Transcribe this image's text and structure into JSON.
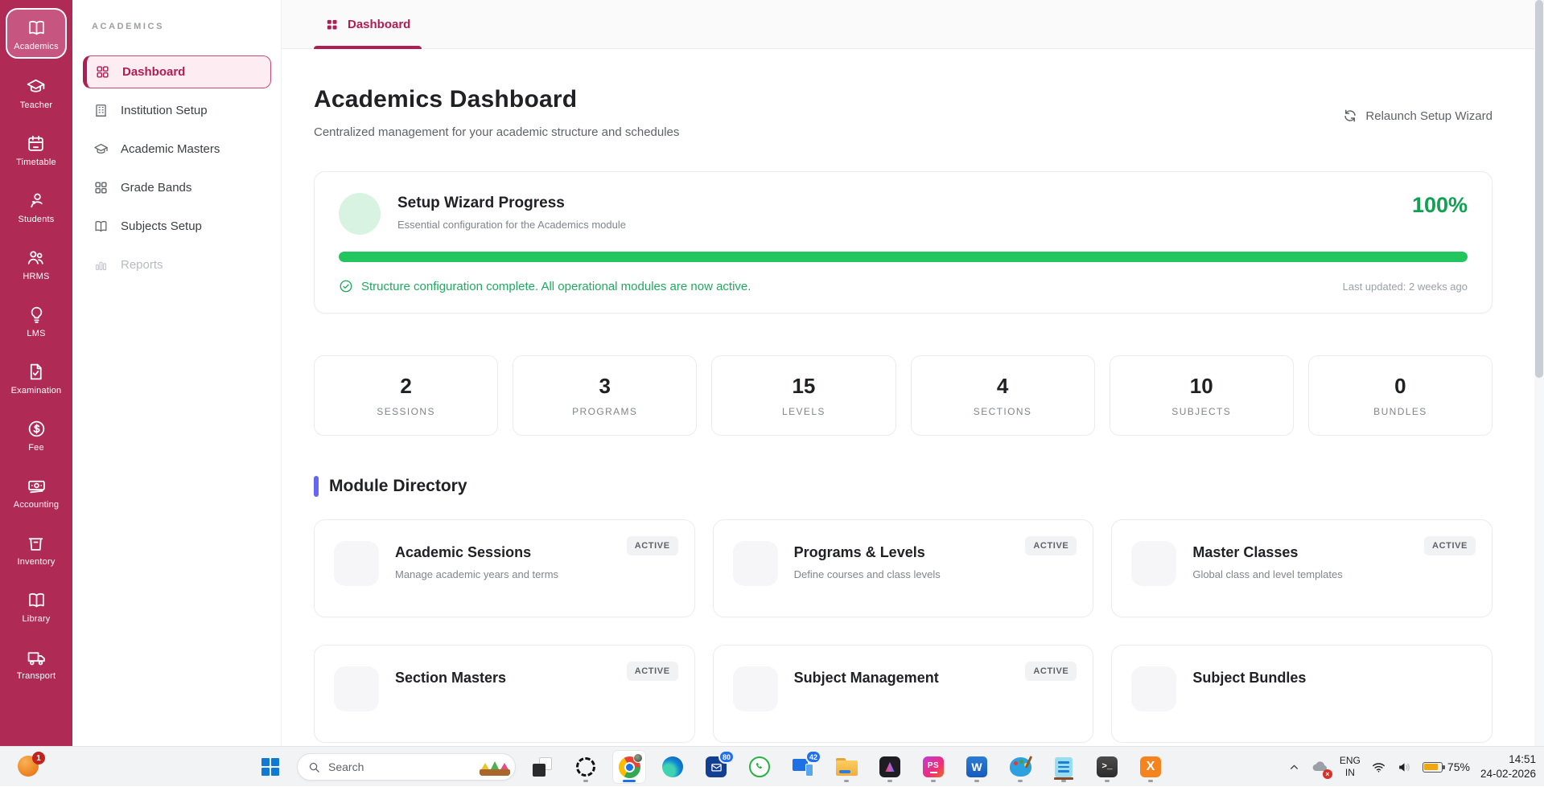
{
  "colors": {
    "rail_bg": "#b02a56",
    "accent": "#b01d53",
    "progress_green": "#22c55e",
    "status_green": "#1faa5f",
    "module_heading_bar": "#6366f1"
  },
  "app_rail": {
    "items": [
      {
        "label": "Academics",
        "icon": "book-open-icon",
        "active": true
      },
      {
        "label": "Teacher",
        "icon": "graduation-cap-icon"
      },
      {
        "label": "Timetable",
        "icon": "calendar-icon"
      },
      {
        "label": "Students",
        "icon": "student-icon"
      },
      {
        "label": "HRMS",
        "icon": "people-icon"
      },
      {
        "label": "LMS",
        "icon": "lightbulb-icon"
      },
      {
        "label": "Examination",
        "icon": "document-check-icon"
      },
      {
        "label": "Fee",
        "icon": "dollar-circle-icon"
      },
      {
        "label": "Accounting",
        "icon": "banknote-icon"
      },
      {
        "label": "Inventory",
        "icon": "box-icon"
      },
      {
        "label": "Library",
        "icon": "book-icon"
      },
      {
        "label": "Transport",
        "icon": "truck-icon"
      }
    ]
  },
  "sidebar": {
    "section_title": "ACADEMICS",
    "items": [
      {
        "label": "Dashboard",
        "active": true
      },
      {
        "label": "Institution Setup"
      },
      {
        "label": "Academic Masters"
      },
      {
        "label": "Grade Bands"
      },
      {
        "label": "Subjects Setup"
      },
      {
        "label": "Reports",
        "disabled": true
      }
    ]
  },
  "tabbar": {
    "active_tab": "Dashboard"
  },
  "header": {
    "title": "Academics Dashboard",
    "subtitle": "Centralized management for your academic structure and schedules",
    "action_label": "Relaunch Setup Wizard"
  },
  "wizard": {
    "title": "Setup Wizard Progress",
    "subtitle": "Essential configuration for the Academics module",
    "percent": "100%",
    "status": "Structure configuration complete. All operational modules are now active.",
    "last_updated": "Last updated: 2 weeks ago"
  },
  "stats": [
    {
      "value": "2",
      "label": "SESSIONS"
    },
    {
      "value": "3",
      "label": "PROGRAMS"
    },
    {
      "value": "15",
      "label": "LEVELS"
    },
    {
      "value": "4",
      "label": "SECTIONS"
    },
    {
      "value": "10",
      "label": "SUBJECTS"
    },
    {
      "value": "0",
      "label": "BUNDLES"
    }
  ],
  "modules": {
    "heading": "Module Directory",
    "cards": [
      {
        "title": "Academic Sessions",
        "desc": "Manage academic years and terms",
        "badge": "ACTIVE"
      },
      {
        "title": "Programs & Levels",
        "desc": "Define courses and class levels",
        "badge": "ACTIVE"
      },
      {
        "title": "Master Classes",
        "desc": "Global class and level templates",
        "badge": "ACTIVE"
      },
      {
        "title": "Section Masters",
        "badge": "ACTIVE"
      },
      {
        "title": "Subject Management",
        "badge": "ACTIVE"
      },
      {
        "title": "Subject Bundles"
      }
    ]
  },
  "taskbar": {
    "search_placeholder": "Search",
    "notification_badge": "1",
    "mail_badge": "80",
    "devices_badge": "42",
    "tray": {
      "lang_line1": "ENG",
      "lang_line2": "IN",
      "battery": "75%",
      "time": "14:51",
      "date": "24-02-2026"
    }
  }
}
